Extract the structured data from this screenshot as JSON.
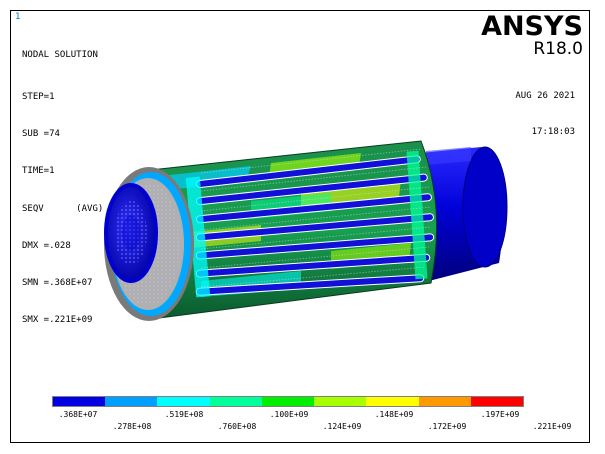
{
  "window_number": "1",
  "info": {
    "title": "NODAL SOLUTION",
    "lines": [
      "STEP=1",
      "SUB =74",
      "TIME=1",
      "SEQV      (AVG)",
      "DMX =.028",
      "SMN =.368E+07",
      "SMX =.221E+09"
    ]
  },
  "logo": {
    "brand": "ANSYS",
    "version": "R18.0"
  },
  "datetime": {
    "date": "AUG 26 2021",
    "time": "17:18:03"
  },
  "legend": {
    "colors": [
      "#0000e0",
      "#00a0ff",
      "#00ffff",
      "#00ff99",
      "#00ee00",
      "#a8ff00",
      "#ffff00",
      "#ff9900",
      "#ff0000"
    ],
    "labels_lower": [
      ".368E+07",
      ".519E+08",
      ".100E+09",
      ".148E+09",
      ".197E+09"
    ],
    "labels_upper": [
      ".278E+08",
      ".760E+08",
      ".124E+09",
      ".172E+09",
      ".221E+09"
    ]
  }
}
